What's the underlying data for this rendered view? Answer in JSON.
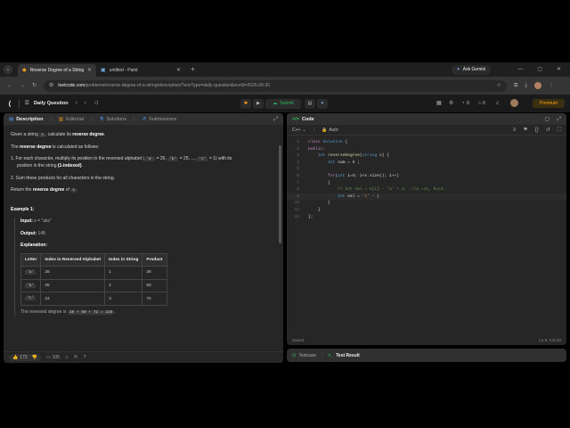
{
  "browser": {
    "tabs": [
      {
        "title": "Reverse Degree of a String - Le",
        "active": true
      },
      {
        "title": "untitled - Paint",
        "active": false
      }
    ],
    "ask_gemini": "Ask Gemini",
    "url_host": "leetcode.com",
    "url_path": "/problems/reverse-degree-of-a-string/description/?envType=daily-question&envId=2026-09-20"
  },
  "leetcode_header": {
    "section": "Daily Question",
    "submit": "Submit",
    "premium": "Premium",
    "count_a": "0",
    "count_b": "0"
  },
  "description_panel": {
    "tabs": [
      "Description",
      "Editorial",
      "Solutions",
      "Submissions"
    ],
    "intro_pre": "Given a string ",
    "intro_code": "s",
    "intro_mid": ", calculate its ",
    "intro_bold": "reverse degree",
    "intro_end": ".",
    "def_pre": "The ",
    "def_bold": "reverse degree",
    "def_end": " is calculated as follows:",
    "step1_pre": "1. For each character, multiply its position in the reversed alphabet (",
    "step1_a": "'a'",
    "step1_a_val": " = 26, ",
    "step1_b": "'b'",
    "step1_b_val": " = 25, ..., ",
    "step1_z": "'z'",
    "step1_z_val": " = 1) with its",
    "step1_line2": "position in the string ",
    "step1_bold": "(1-indexed)",
    "step1_end": ".",
    "step2": "2. Sum these products for all characters in the string.",
    "return_pre": "Return the ",
    "return_bold": "reverse degree",
    "return_mid": " of ",
    "return_code": "s",
    "return_end": ".",
    "example_title": "Example 1:",
    "input_label": "Input:",
    "input_value": "s = \"abc\"",
    "output_label": "Output:",
    "output_value": "148",
    "explanation_label": "Explanation:",
    "table_headers": [
      "Letter",
      "Index in Reversed Alphabet",
      "Index in String",
      "Product"
    ],
    "table_rows": [
      [
        "'a'",
        "26",
        "1",
        "26"
      ],
      [
        "'b'",
        "25",
        "2",
        "50"
      ],
      [
        "'c'",
        "24",
        "3",
        "72"
      ]
    ],
    "summary_pre": "The reversed degree is ",
    "summary_code": "26 + 50 + 72 = 148",
    "summary_end": ".",
    "likes": "173",
    "comments": "105"
  },
  "code_panel": {
    "title": "Code",
    "language": "C++",
    "autocomplete": "Auto",
    "saved": "Saved",
    "cursor": "Ln 9, Col 20",
    "lines": [
      [
        {
          "t": "class ",
          "c": "kw"
        },
        {
          "t": "Solution",
          "c": "ty"
        },
        {
          "t": " {",
          "c": ""
        }
      ],
      [
        {
          "t": "public:",
          "c": "kw"
        }
      ],
      [
        {
          "t": "    int ",
          "c": "ty"
        },
        {
          "t": "reverseDegree",
          "c": "fn"
        },
        {
          "t": "(",
          "c": ""
        },
        {
          "t": "string",
          "c": "ty"
        },
        {
          "t": " s) {",
          "c": ""
        }
      ],
      [
        {
          "t": "        int ",
          "c": "ty"
        },
        {
          "t": "sum = ",
          "c": ""
        },
        {
          "t": "0",
          "c": "nu"
        },
        {
          "t": " ;",
          "c": ""
        }
      ],
      [
        {
          "t": "",
          "c": ""
        }
      ],
      [
        {
          "t": "        for",
          "c": "kw"
        },
        {
          "t": "(",
          "c": ""
        },
        {
          "t": "int ",
          "c": "ty"
        },
        {
          "t": "i=",
          "c": ""
        },
        {
          "t": "0",
          "c": "nu"
        },
        {
          "t": "; i<s.size(); i++)",
          "c": ""
        }
      ],
      [
        {
          "t": "        {",
          "c": ""
        }
      ],
      [
        {
          "t": "            // int val = s[i] - 'a' + 1;  //a =c1, b=c2...",
          "c": "cm"
        }
      ],
      [
        {
          "t": "            int ",
          "c": "ty"
        },
        {
          "t": "val = ",
          "c": ""
        },
        {
          "t": "'z'",
          "c": "st"
        },
        {
          "t": " - |",
          "c": ""
        }
      ],
      [
        {
          "t": "        }",
          "c": ""
        }
      ],
      [
        {
          "t": "    }",
          "c": ""
        }
      ],
      [
        {
          "t": "};",
          "c": ""
        }
      ]
    ]
  },
  "bottom_panel": {
    "testcase": "Testcase",
    "test_result": "Test Result"
  },
  "colors": {
    "submit_green": "#2cbb5d",
    "premium_orange": "#ffa116",
    "link_blue": "#4a9eff"
  }
}
